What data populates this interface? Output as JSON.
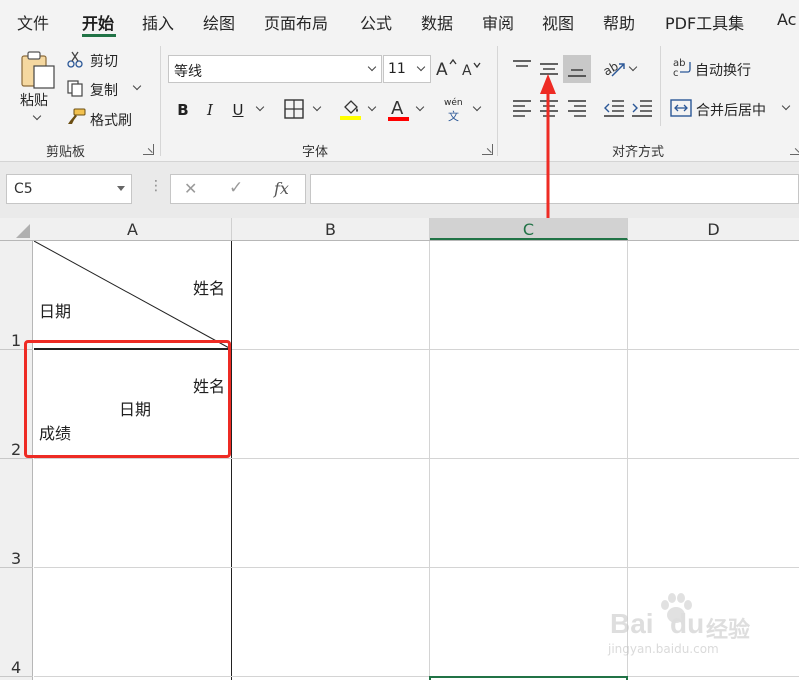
{
  "tabs": [
    {
      "label": "文件"
    },
    {
      "label": "开始"
    },
    {
      "label": "插入"
    },
    {
      "label": "绘图"
    },
    {
      "label": "页面布局"
    },
    {
      "label": "公式"
    },
    {
      "label": "数据"
    },
    {
      "label": "审阅"
    },
    {
      "label": "视图"
    },
    {
      "label": "帮助"
    },
    {
      "label": "PDF工具集"
    },
    {
      "label": "Ac"
    }
  ],
  "clipboard": {
    "paste": "粘贴",
    "cut": "剪切",
    "copy": "复制",
    "format_painter": "格式刷",
    "group": "剪贴板"
  },
  "font": {
    "name": "等线",
    "size": "11",
    "bold": "B",
    "italic": "I",
    "underline": "U",
    "pinyin_top": "wén",
    "pinyin_bottom": "文",
    "group": "字体",
    "fill_color": "#ffff00",
    "font_color": "#ff0000"
  },
  "alignment": {
    "wrap_text": "自动换行",
    "merge_center": "合并后居中",
    "group": "对齐方式"
  },
  "formula_bar": {
    "name_box": "C5",
    "cancel": "✕",
    "enter": "✓",
    "fx": "fx",
    "value": ""
  },
  "columns": [
    {
      "label": "A"
    },
    {
      "label": "B"
    },
    {
      "label": "C"
    },
    {
      "label": "D"
    }
  ],
  "rows": [
    {
      "label": "1"
    },
    {
      "label": "2"
    },
    {
      "label": "3"
    },
    {
      "label": "4"
    }
  ],
  "cells": {
    "a1_top_right": "姓名",
    "a1_bottom_left": "日期",
    "a2_top_right": "姓名",
    "a2_middle": "日期",
    "a2_bottom_left": "成绩"
  },
  "watermark": {
    "brand": "Bai",
    "brand2": "du",
    "brand_cn": "经验",
    "url": "jingyan.baidu.com"
  },
  "colors": {
    "accent_green": "#217346",
    "annotation_red": "#ee2b24"
  }
}
